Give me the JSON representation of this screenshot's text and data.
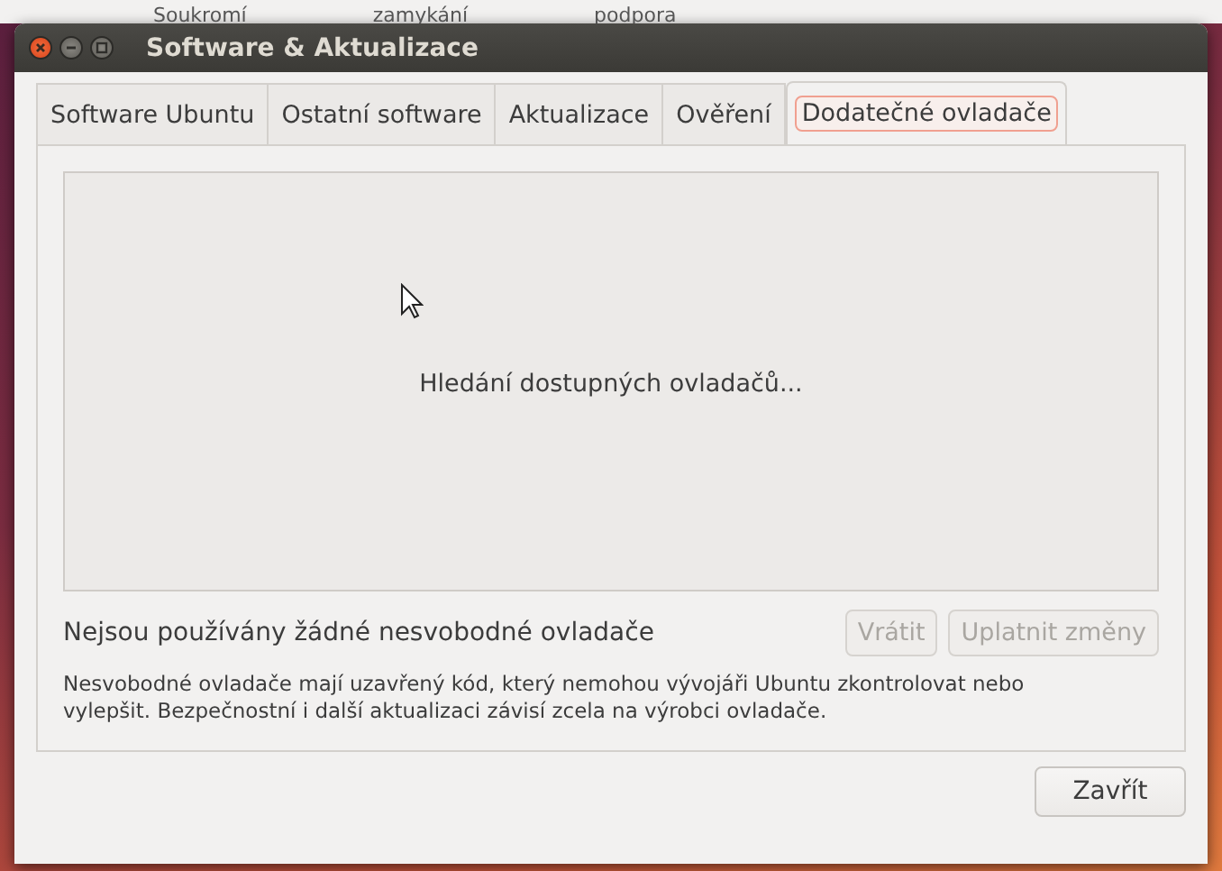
{
  "background_window": {
    "labels": [
      "Soukromí",
      "zamykání",
      "podpora"
    ]
  },
  "window": {
    "title": "Software & Aktualizace"
  },
  "tabs": [
    {
      "label": "Software Ubuntu",
      "selected": false
    },
    {
      "label": "Ostatní software",
      "selected": false
    },
    {
      "label": "Aktualizace",
      "selected": false
    },
    {
      "label": "Ověření",
      "selected": false
    },
    {
      "label": "Dodatečné ovladače",
      "selected": true
    }
  ],
  "drivers_panel": {
    "status": "Hledání dostupných ovladačů..."
  },
  "summary": "Nejsou používány žádné nesvobodné ovladače",
  "actions": [
    {
      "label": "Vrátit",
      "disabled": true
    },
    {
      "label": "Uplatnit změny",
      "disabled": true
    }
  ],
  "note": "Nesvobodné ovladače mají uzavřený kód, který nemohou vývojáři Ubuntu zkontrolovat nebo vylepšit. Bezpečnostní i další aktualizaci závisí zcela na výrobci ovladače.",
  "close_button": {
    "label": "Zavřít"
  }
}
